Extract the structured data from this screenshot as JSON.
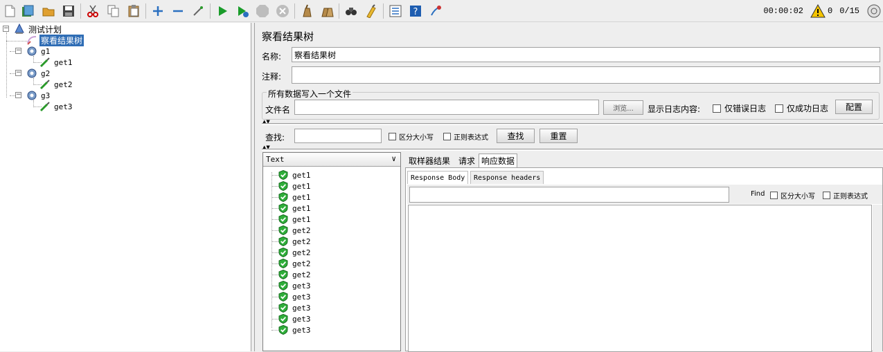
{
  "toolbar": {
    "timer": "00:00:02",
    "warning_count": "0",
    "thread_ratio": "0/15",
    "icons": [
      "new-icon",
      "templates-icon",
      "open-icon",
      "save-icon",
      "cut-icon",
      "copy-icon",
      "paste-icon",
      "expand-icon",
      "collapse-icon",
      "toggle-icon",
      "start-icon",
      "start-no-pause-icon",
      "stop-icon",
      "shutdown-icon",
      "clear-icon",
      "clear-all-icon",
      "search-icon",
      "reset-search-icon",
      "function-helper-icon",
      "help-icon",
      "remote-icon"
    ],
    "colors": {
      "play": "#1a9c2a",
      "stop": "#bdbdbd",
      "warning": "#f5c400"
    }
  },
  "tree": {
    "root": "测试计划",
    "listener": "察看结果树",
    "groups": [
      {
        "name": "g1",
        "sampler": "get1"
      },
      {
        "name": "g2",
        "sampler": "get2"
      },
      {
        "name": "g3",
        "sampler": "get3"
      }
    ]
  },
  "panel": {
    "title": "察看结果树",
    "name_label": "名称:",
    "name_value": "察看结果树",
    "comment_label": "注释:",
    "comment_value": "",
    "file_group_title": "所有数据写入一个文件",
    "filename_label": "文件名",
    "filename_value": "",
    "browse_label": "浏览...",
    "log_label": "显示日志内容:",
    "errors_only_label": "仅错误日志",
    "success_only_label": "仅成功日志",
    "configure_label": "配置",
    "search_label": "查找:",
    "search_value": "",
    "case_label": "区分大小写",
    "regex_label": "正则表达式",
    "find_button": "查找",
    "reset_button": "重置"
  },
  "results": {
    "renderer": "Text",
    "items": [
      "get1",
      "get1",
      "get1",
      "get1",
      "get1",
      "get2",
      "get2",
      "get2",
      "get2",
      "get2",
      "get3",
      "get3",
      "get3",
      "get3",
      "get3"
    ]
  },
  "tabs": {
    "main": [
      "取样器结果",
      "请求",
      "响应数据"
    ],
    "sub": [
      "Response Body",
      "Response headers"
    ],
    "find_label": "Find",
    "case_label": "区分大小写",
    "regex_label": "正则表达式",
    "find_value": ""
  }
}
